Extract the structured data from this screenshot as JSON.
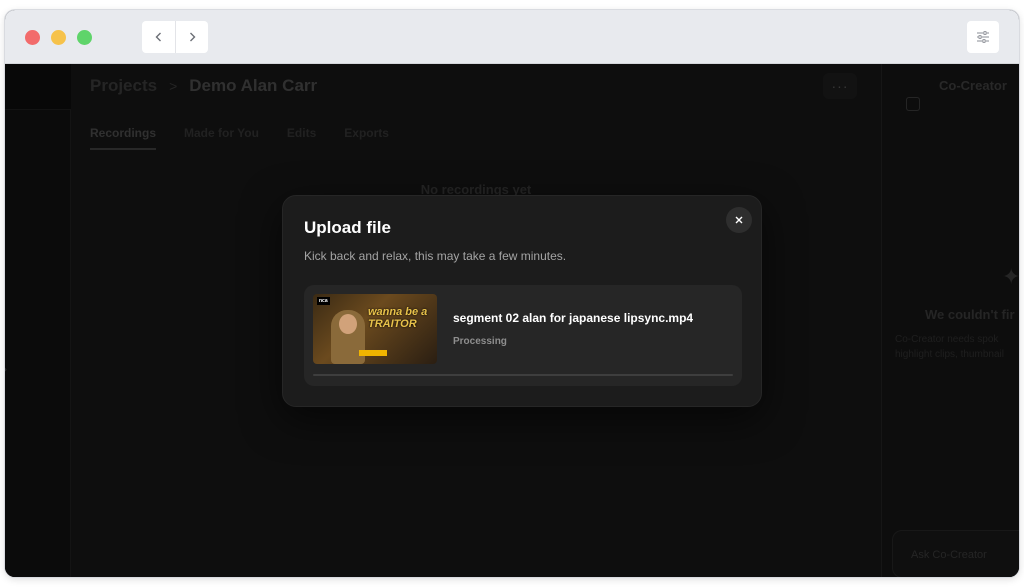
{
  "titlebar": {
    "back_icon": "chevron-left-icon",
    "forward_icon": "chevron-right-icon",
    "settings_icon": "sliders-icon"
  },
  "breadcrumb": {
    "root": "Projects",
    "separator": ">",
    "current": "Demo Alan Carr"
  },
  "more_button_label": "···",
  "tabs": [
    "Recordings",
    "Made for You",
    "Edits",
    "Exports"
  ],
  "active_tab": "Recordings",
  "empty_state": "No recordings yet",
  "right_panel": {
    "title": "Co-Creator",
    "heading": "We couldn't fir",
    "body_line1": "Co-Creator needs spok",
    "body_line2": "highlight clips, thumbnail",
    "ask_placeholder": "Ask Co-Creator"
  },
  "modal": {
    "title": "Upload file",
    "subtitle": "Kick back and relax, this may take a few minutes.",
    "file": {
      "name": "segment 02 alan for japanese lipsync.mp4",
      "status": "Processing",
      "thumbnail_logo": "nca",
      "thumbnail_caption": "wanna be a TRAITOR",
      "progress": 0
    }
  }
}
